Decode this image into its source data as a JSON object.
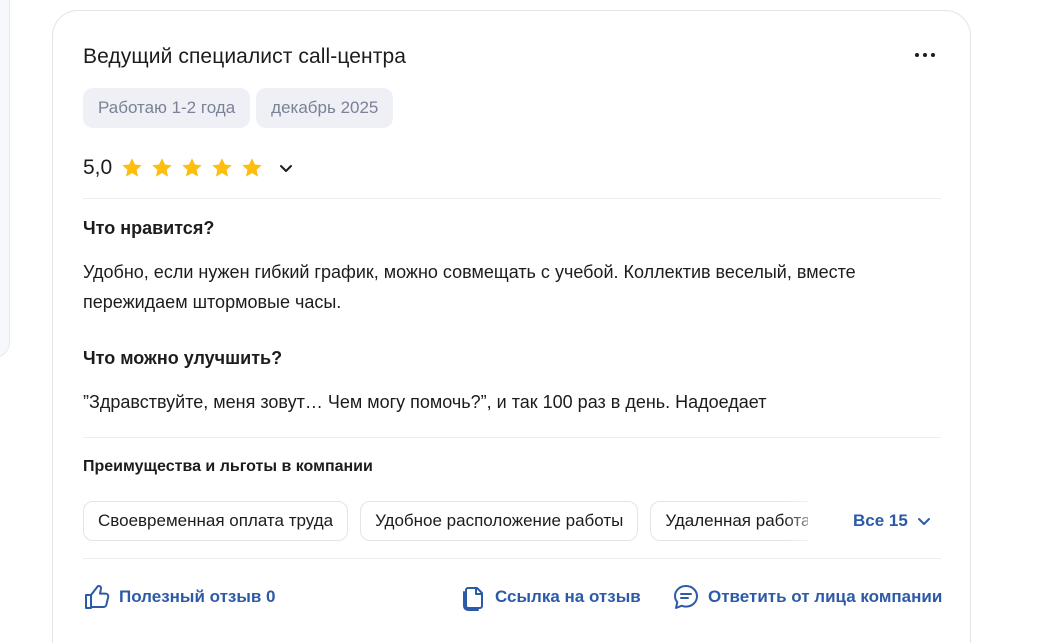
{
  "review": {
    "title": "Ведущий специалист call-центра",
    "tags": [
      "Работаю 1-2 года",
      "декабрь 2025"
    ],
    "rating": {
      "value_label": "5,0",
      "stars": 5,
      "max_stars": 5
    },
    "likes": {
      "title": "Что нравится?",
      "text": "Удобно, если нужен гибкий график, можно совмещать с учебой. Коллектив веселый, вместе пережидаем штормовые часы."
    },
    "improve": {
      "title": "Что можно улучшить?",
      "text": "”Здравствуйте, меня зовут… Чем могу помочь?”, и так 100 раз в день. Надоедает"
    },
    "benefits": {
      "title": "Преимущества и льготы в компании",
      "chips": [
        "Своевременная оплата труда",
        "Удобное расположение работы",
        "Удаленная работа"
      ],
      "all_label": "Все 15"
    },
    "actions": {
      "helpful": "Полезный отзыв 0",
      "link": "Ссылка на отзыв",
      "reply": "Ответить от лица компании"
    }
  },
  "colors": {
    "accent": "#2d5aa8",
    "star": "#fdbe10",
    "tag_bg": "#eef0f6",
    "tag_text": "#7b8196"
  },
  "icons": [
    "more-icon",
    "star-icon",
    "chevron-down-icon",
    "thumb-up-icon",
    "copy-link-icon",
    "chat-reply-icon"
  ]
}
